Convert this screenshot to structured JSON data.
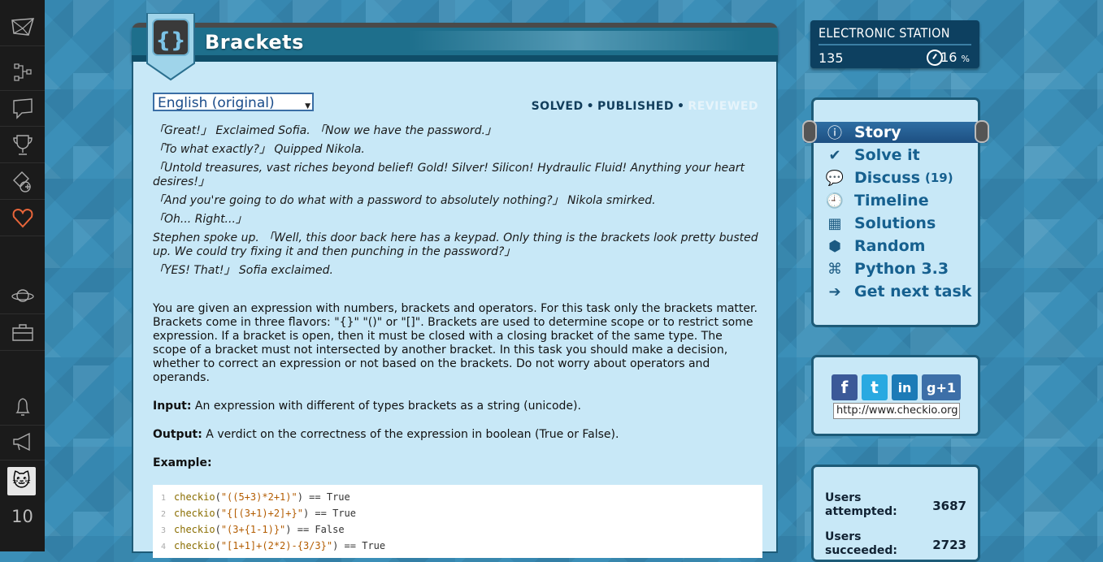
{
  "rail": {
    "items": [
      "logo",
      "tree",
      "chat",
      "trophy",
      "add-mission",
      "favorites",
      "planet",
      "briefcase",
      "bell",
      "megaphone"
    ],
    "level": "10"
  },
  "task": {
    "title": "Brackets",
    "badge_glyph": "{}",
    "language": "English (original)",
    "status": {
      "solved": "SOLVED",
      "published": "PUBLISHED",
      "reviewed": "REVIEWED",
      "dot": "•"
    },
    "story": [
      "「Great!」 Exclaimed Sofia. 「Now we have the password.」",
      "「To what exactly?」 Quipped Nikola.",
      "「Untold treasures, vast riches beyond belief! Gold! Silver! Silicon! Hydraulic Fluid! Anything your heart desires!」",
      "「And you're going to do what with a password to absolutely nothing?」 Nikola smirked.",
      "「Oh... Right...」",
      "Stephen spoke up. 「Well, this door back here has a keypad. Only thing is the brackets look pretty busted up. We could try fixing it and then punching in the password?」",
      "「YES! That!」 Sofia exclaimed."
    ],
    "description": "You are given an expression with numbers, brackets and operators. For this task only the brackets matter. Brackets come in three flavors: \"{}\" \"()\" or \"[]\". Brackets are used to determine scope or to restrict some expression. If a bracket is open, then it must be closed with a closing bracket of the same type. The scope of a bracket must not intersected by another bracket. In this task you should make a decision, whether to correct an expression or not based on the brackets. Do not worry about operators and operands.",
    "input_label": "Input:",
    "input_text": "An expression with different of types brackets as a string (unicode).",
    "output_label": "Output:",
    "output_text": "A verdict on the correctness of the expression in boolean (True or False).",
    "example_label": "Example:",
    "code": [
      {
        "n": "1",
        "fn": "checkio",
        "open": "(",
        "arg": "\"((5+3)*2+1)\"",
        "rest": ") == True"
      },
      {
        "n": "2",
        "fn": "checkio",
        "open": "(",
        "arg": "\"{[(3+1)+2]+}\"",
        "rest": ") == True"
      },
      {
        "n": "3",
        "fn": "checkio",
        "open": "(",
        "arg": "\"(3+{1-1)}\"",
        "rest": ") == False"
      },
      {
        "n": "4",
        "fn": "checkio",
        "open": "(",
        "arg": "\"[1+1]+(2*2)-{3/3}\"",
        "rest": ") == True"
      }
    ]
  },
  "station": {
    "name": "ELECTRONIC STATION",
    "count": "135",
    "percent": "16",
    "percent_sign": "%"
  },
  "nav": {
    "story": "Story",
    "solve": "Solve it",
    "discuss": "Discuss",
    "discuss_count": "(19)",
    "timeline": "Timeline",
    "solutions": "Solutions",
    "random": "Random",
    "python": "Python 3.3",
    "next": "Get next task"
  },
  "share": {
    "url": "http://www.checkio.org",
    "networks": [
      "facebook",
      "twitter",
      "linkedin",
      "google-plus"
    ],
    "glyphs": {
      "facebook": "f",
      "twitter": "t",
      "linkedin": "in",
      "google_plus": "g+1"
    }
  },
  "stats": {
    "attempted_label": "Users attempted:",
    "attempted": "3687",
    "succeeded_label": "Users succeeded:",
    "succeeded": "2723"
  },
  "colors": {
    "accent": "#e8653a",
    "nav_text": "#16608f",
    "panel": "#c8e8f7",
    "header": "#1e6f8c"
  }
}
